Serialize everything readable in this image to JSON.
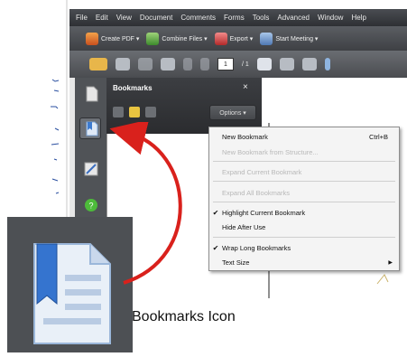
{
  "menubar": {
    "items": [
      "File",
      "Edit",
      "View",
      "Document",
      "Comments",
      "Forms",
      "Tools",
      "Advanced",
      "Window",
      "Help"
    ]
  },
  "toolbar": {
    "create_pdf": "Create PDF ▾",
    "combine_files": "Combine Files ▾",
    "export": "Export ▾",
    "start_meeting": "Start Meeting ▾",
    "page_current": "1",
    "page_total": "/ 1"
  },
  "bookmarks_panel": {
    "title": "Bookmarks",
    "close": "×",
    "options_label": "Options ▾"
  },
  "options_menu": {
    "items": [
      {
        "label": "New Bookmark",
        "shortcut": "Ctrl+B",
        "enabled": true,
        "checked": false
      },
      {
        "label": "New Bookmark from Structure...",
        "shortcut": "",
        "enabled": false,
        "checked": false
      },
      {
        "label": "Expand Current Bookmark",
        "shortcut": "",
        "enabled": false,
        "checked": false
      },
      {
        "label": "Expand All Bookmarks",
        "shortcut": "",
        "enabled": false,
        "checked": false
      },
      {
        "label": "Highlight Current Bookmark",
        "shortcut": "",
        "enabled": true,
        "checked": true
      },
      {
        "label": "Hide After Use",
        "shortcut": "",
        "enabled": true,
        "checked": false
      },
      {
        "label": "Wrap Long Bookmarks",
        "shortcut": "",
        "enabled": true,
        "checked": true
      },
      {
        "label": "Text Size",
        "shortcut": "",
        "enabled": true,
        "checked": false,
        "submenu": true
      }
    ]
  },
  "callout": {
    "label": "Bookmarks Icon"
  },
  "colors": {
    "panel_dark": "#2b2c2f",
    "icon_blue": "#5b9bd5",
    "arrow_red": "#d9211c"
  }
}
